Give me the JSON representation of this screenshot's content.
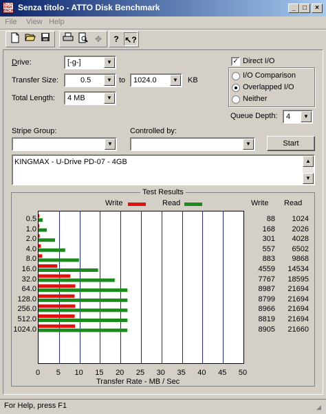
{
  "window": {
    "title": "Senza titolo - ATTO Disk Benchmark"
  },
  "menu": [
    "File",
    "View",
    "Help"
  ],
  "toolbar": {
    "icons": [
      "new-icon",
      "open-icon",
      "save-icon",
      "print-icon",
      "print-preview-icon",
      "move-icon",
      "help-icon",
      "context-help-icon"
    ]
  },
  "form": {
    "drive_label": "Drive:",
    "drive_value": "[-g-]",
    "transfer_label": "Transfer Size:",
    "transfer_from": "0.5",
    "to_label": "to",
    "transfer_to": "1024.0",
    "kb_label": "KB",
    "length_label": "Total Length:",
    "length_value": "4 MB",
    "direct_io_label": "Direct I/O",
    "direct_io_checked": true,
    "io_options": [
      "I/O Comparison",
      "Overlapped I/O",
      "Neither"
    ],
    "io_selected": "Overlapped I/O",
    "queue_label": "Queue Depth:",
    "queue_value": "4",
    "stripe_label": "Stripe Group:",
    "stripe_value": "",
    "controlled_label": "Controlled by:",
    "controlled_value": "",
    "start_label": "Start",
    "description": "KINGMAX - U-Drive PD-07 - 4GB"
  },
  "results": {
    "group_title": "Test Results",
    "write_legend": "Write",
    "read_legend": "Read",
    "write_header": "Write",
    "read_header": "Read",
    "rows": [
      {
        "size": "0.5",
        "write": "88",
        "read": "1024"
      },
      {
        "size": "1.0",
        "write": "168",
        "read": "2026"
      },
      {
        "size": "2.0",
        "write": "301",
        "read": "4028"
      },
      {
        "size": "4.0",
        "write": "557",
        "read": "6502"
      },
      {
        "size": "8.0",
        "write": "883",
        "read": "9868"
      },
      {
        "size": "16.0",
        "write": "4559",
        "read": "14534"
      },
      {
        "size": "32.0",
        "write": "7767",
        "read": "18595"
      },
      {
        "size": "64.0",
        "write": "8987",
        "read": "21694"
      },
      {
        "size": "128.0",
        "write": "8799",
        "read": "21694"
      },
      {
        "size": "256.0",
        "write": "8966",
        "read": "21694"
      },
      {
        "size": "512.0",
        "write": "8819",
        "read": "21694"
      },
      {
        "size": "1024.0",
        "write": "8905",
        "read": "21660"
      }
    ],
    "xlabel": "Transfer Rate - MB / Sec"
  },
  "chart_data": {
    "type": "bar",
    "orientation": "horizontal",
    "categories": [
      "0.5",
      "1.0",
      "2.0",
      "4.0",
      "8.0",
      "16.0",
      "32.0",
      "64.0",
      "128.0",
      "256.0",
      "512.0",
      "1024.0"
    ],
    "series": [
      {
        "name": "Write",
        "color": "#e01010",
        "values": [
          0.088,
          0.168,
          0.301,
          0.557,
          0.883,
          4.559,
          7.767,
          8.987,
          8.799,
          8.966,
          8.819,
          8.905
        ]
      },
      {
        "name": "Read",
        "color": "#1a8a1a",
        "values": [
          1.024,
          2.026,
          4.028,
          6.502,
          9.868,
          14.534,
          18.595,
          21.694,
          21.694,
          21.694,
          21.694,
          21.66
        ]
      }
    ],
    "xlabel": "Transfer Rate - MB / Sec",
    "xlim": [
      0,
      50
    ],
    "xticks": [
      "0",
      "5",
      "10",
      "15",
      "20",
      "25",
      "30",
      "35",
      "40",
      "45",
      "50"
    ],
    "grid": true,
    "legend": "top"
  },
  "status": {
    "text": "For Help, press F1"
  }
}
